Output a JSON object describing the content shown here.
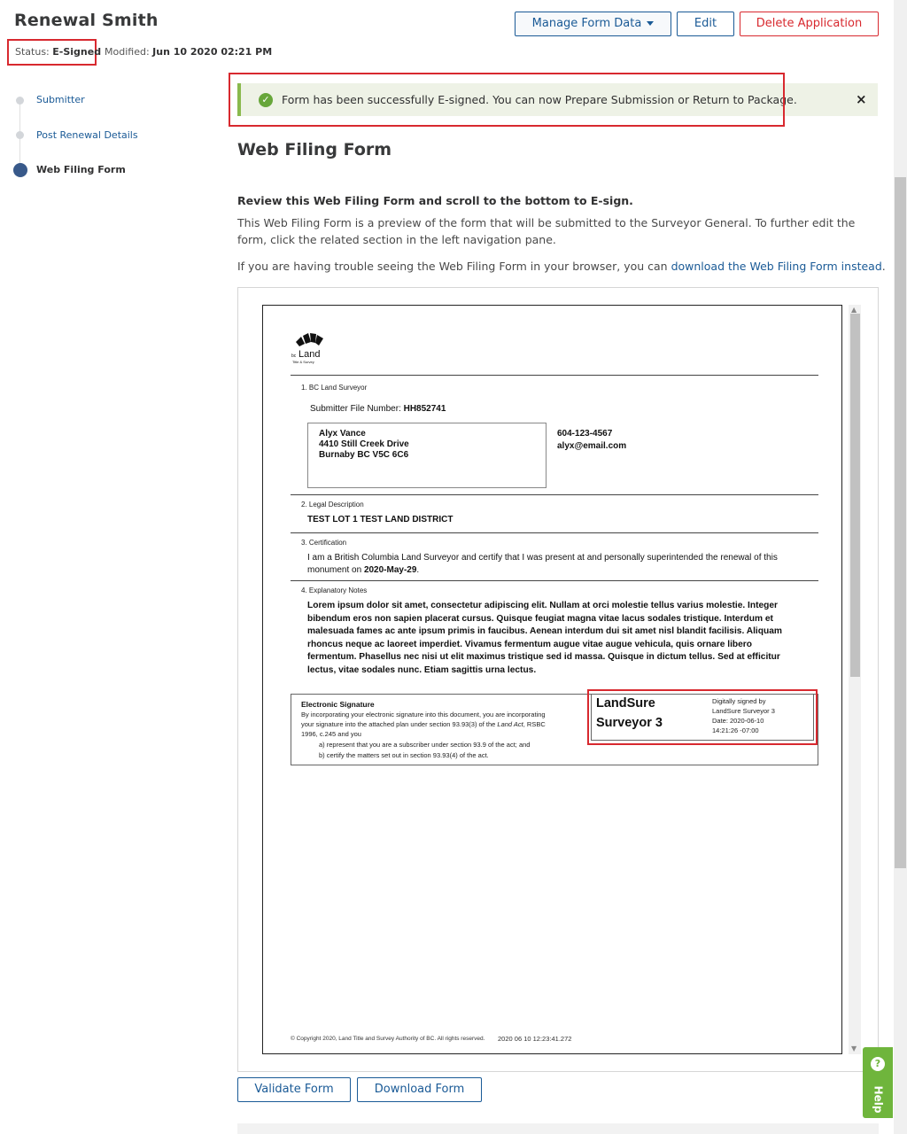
{
  "header": {
    "title": "Renewal Smith",
    "status_label": "Status:",
    "status_value": "E-Signed",
    "modified_label": "Modified:",
    "modified_value": "Jun 10 2020 02:21 PM",
    "manage_label": "Manage Form Data",
    "edit_label": "Edit",
    "delete_label": "Delete Application"
  },
  "sidebar": {
    "items": [
      {
        "label": "Submitter",
        "active": false
      },
      {
        "label": "Post Renewal Details",
        "active": false
      },
      {
        "label": "Web Filing Form",
        "active": true
      }
    ]
  },
  "alert": {
    "message": "Form has been successfully E-signed. You can now Prepare Submission or Return to Package.",
    "close": "×"
  },
  "main": {
    "title": "Web Filing Form",
    "review_heading": "Review this Web Filing Form and scroll to the bottom to E-sign.",
    "description": "This Web Filing Form is a preview of the form that will be submitted to the Surveyor General. To further edit the form, click the related section in the left navigation pane.",
    "trouble_text": "If you are having trouble seeing the Web Filing Form in your browser, you can ",
    "download_link": "download the Web Filing Form instead",
    "trouble_end": "."
  },
  "document": {
    "logo_text": "Land",
    "logo_prefix": "bc",
    "logo_sub": "Title & Survey",
    "sec1_label": "1. BC Land Surveyor",
    "submitter_file_label": "Submitter File Number:",
    "submitter_file_value": "HH852741",
    "address": [
      "Alyx Vance",
      "4410 Still Creek Drive",
      "Burnaby BC V5C 6C6"
    ],
    "phone": "604-123-4567",
    "email": "alyx@email.com",
    "sec2_label": "2. Legal Description",
    "legal_description": "TEST LOT 1 TEST LAND DISTRICT",
    "sec3_label": "3. Certification",
    "cert_line1": "I am a British Columbia Land Surveyor and certify that I was present at and personally superintended the renewal of this",
    "cert_line2_prefix": "monument on ",
    "cert_date": "2020-May-29",
    "cert_line2_suffix": ".",
    "sec4_label": "4. Explanatory Notes",
    "notes": "Lorem ipsum dolor sit amet, consectetur adipiscing elit. Nullam at orci molestie tellus varius molestie. Integer bibendum eros non sapien placerat cursus. Quisque feugiat magna vitae lacus sodales tristique. Interdum et malesuada fames ac ante ipsum primis in faucibus. Aenean interdum dui sit amet nisl blandit facilisis. Aliquam rhoncus neque ac laoreet imperdiet. Vivamus fermentum augue vitae augue vehicula, quis ornare libero fermentum. Phasellus nec nisi ut elit maximus tristique sed id massa. Quisque in dictum tellus. Sed at efficitur lectus, vitae sodales nunc. Etiam sagittis urna lectus.",
    "esig_title": "Electronic Signature",
    "esig_line1": "By incorporating your electronic signature into this document, you are incorporating",
    "esig_line2_prefix": "your signature into the attached plan under section 93.93(3) of the ",
    "esig_line2_italic": "Land Act",
    "esig_line2_suffix": ", RSBC",
    "esig_line3": "1996, c.245 and you",
    "esig_a": "a)      represent that you are a subscriber under section 93.9 of the act; and",
    "esig_b": "b)      certify the matters set out in section 93.93(4) of the act.",
    "sig_name_line1": "LandSure",
    "sig_name_line2": "Surveyor 3",
    "sig_meta1": "Digitally signed by",
    "sig_meta2": "LandSure Surveyor 3",
    "sig_meta3": "Date: 2020-06-10",
    "sig_meta4": "14:21:26 -07:00",
    "footer_copyright": "© Copyright 2020, Land Title and Survey Authority of BC. All rights reserved.",
    "footer_timestamp": "2020 06 10 12:23:41.272"
  },
  "actions": {
    "validate_label": "Validate Form",
    "download_label": "Download Form"
  },
  "help": {
    "label": "Help",
    "icon": "?"
  },
  "colors": {
    "accent": "#1a5a96",
    "danger": "#d8292f",
    "success": "#8ab94d",
    "help": "#6fb53c"
  }
}
